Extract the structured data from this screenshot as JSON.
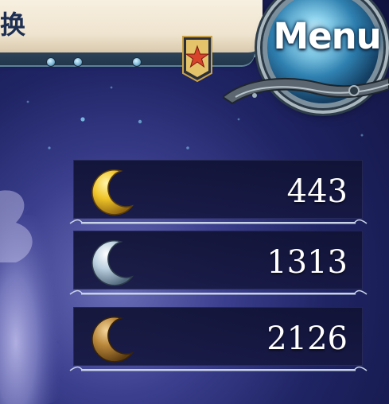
{
  "header": {
    "title_fragment": "换",
    "menu_label": "Menu",
    "rank_badge_icon": "star-ribbon-icon"
  },
  "currencies": [
    {
      "icon": "gold-moon-icon",
      "color": "#d8a91c",
      "amount": "443"
    },
    {
      "icon": "silver-moon-icon",
      "color": "#a9c3d6",
      "amount": "1313"
    },
    {
      "icon": "bronze-moon-icon",
      "color": "#a87a2e",
      "amount": "2126"
    }
  ],
  "colors": {
    "sky_dark": "#10133e",
    "sky_mid": "#3b3f8e",
    "panel": "#16183f",
    "menu_glow": "#8fd4ee"
  }
}
